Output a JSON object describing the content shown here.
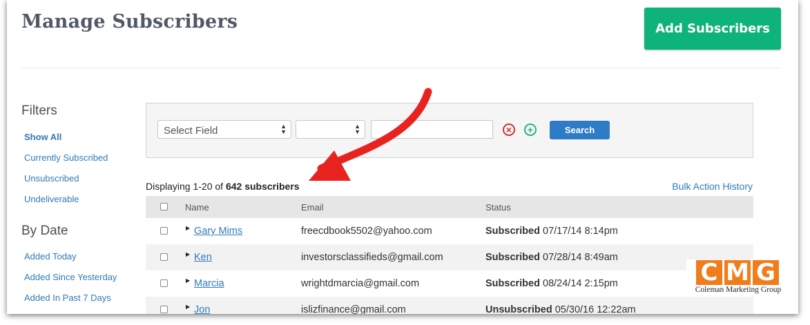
{
  "header": {
    "title": "Manage Subscribers",
    "add_button": "Add Subscribers",
    "add_button_color": "#0db37a"
  },
  "sidebar": {
    "filters_heading": "Filters",
    "filters": [
      "Show All",
      "Currently Subscribed",
      "Unsubscribed",
      "Undeliverable"
    ],
    "by_date_heading": "By Date",
    "by_date": [
      "Added Today",
      "Added Since Yesterday",
      "Added In Past 7 Days"
    ]
  },
  "filter_bar": {
    "select_field": "Select Field",
    "operator_value": "",
    "value_input": "",
    "remove_icon": "circle-x-icon",
    "add_icon": "circle-plus-icon",
    "search_button": "Search"
  },
  "summary": {
    "prefix": "Displaying 1-20 of",
    "count": "642 subscribers",
    "bulk_link": "Bulk Action History"
  },
  "table": {
    "columns": [
      "Name",
      "Email",
      "Status"
    ],
    "rows": [
      {
        "name": "Gary Mims",
        "email": "freecdbook5502@yahoo.com",
        "status": "Subscribed",
        "date": "07/17/14 8:14pm"
      },
      {
        "name": "Ken",
        "email": "investorsclassifieds@gmail.com",
        "status": "Subscribed",
        "date": "07/28/14 8:49am"
      },
      {
        "name": "Marcia",
        "email": "wrightdmarcia@gmail.com",
        "status": "Subscribed",
        "date": "08/24/14 2:15pm"
      },
      {
        "name": "Jon",
        "email": "islizfinance@gmail.com",
        "status": "Unsubscribed",
        "date": "05/30/16 12:22am"
      }
    ]
  },
  "watermark": {
    "letters": [
      "C",
      "M",
      "G"
    ],
    "caption": "Coleman Marketing Group"
  },
  "annotation": {
    "arrow_color": "#e8231f"
  }
}
